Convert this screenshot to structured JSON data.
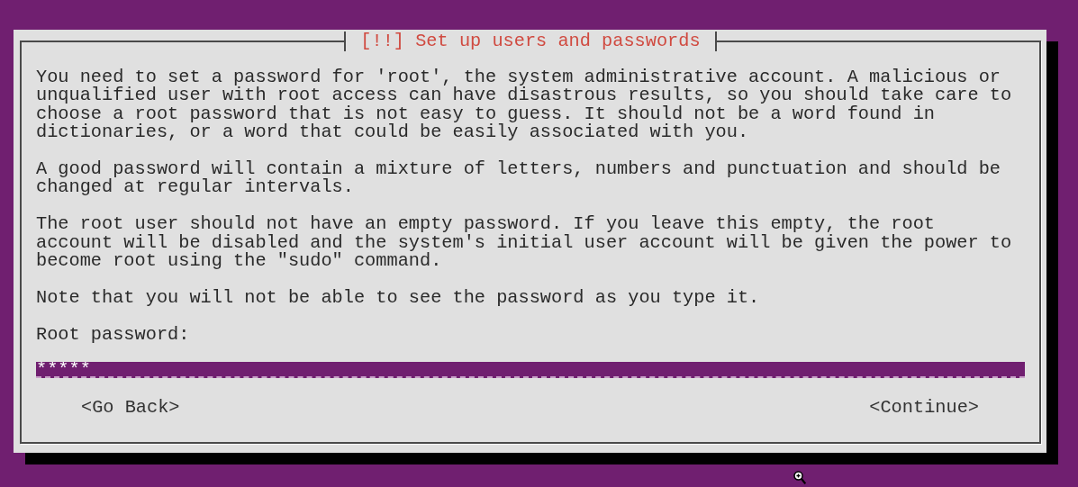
{
  "dialog": {
    "title": "[!!] Set up users and passwords",
    "paragraphs": [
      "You need to set a password for 'root', the system administrative account. A malicious or unqualified user with root access can have disastrous results, so you should take care to choose a root password that is not easy to guess. It should not be a word found in dictionaries, or a word that could be easily associated with you.",
      "A good password will contain a mixture of letters, numbers and punctuation and should be changed at regular intervals.",
      "The root user should not have an empty password. If you leave this empty, the root account will be disabled and the system's initial user account will be given the power to become root using the \"sudo\" command.",
      "Note that you will not be able to see the password as you type it."
    ],
    "field": {
      "label": "Root password:",
      "value": "*****",
      "focused": true
    },
    "buttons": [
      {
        "label": "<Go Back>",
        "selected": false
      },
      {
        "label": "<Continue>",
        "selected": false
      }
    ]
  }
}
